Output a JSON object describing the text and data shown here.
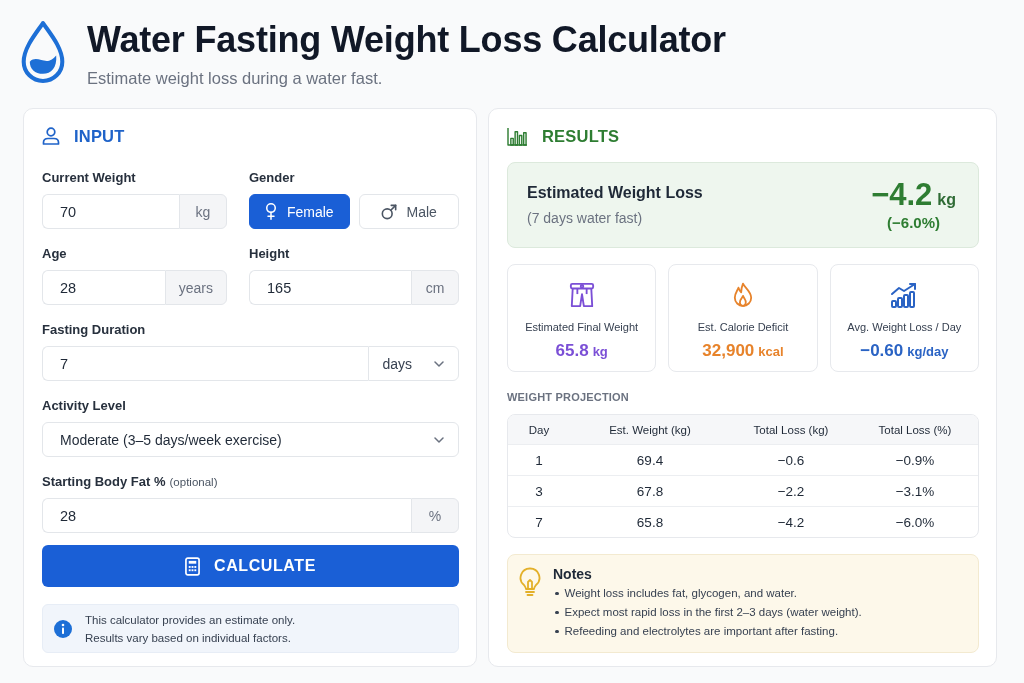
{
  "header": {
    "title": "Water Fasting Weight Loss Calculator",
    "subtitle": "Estimate weight loss during a water fast."
  },
  "input_panel": {
    "title": "INPUT",
    "rows": [
      {
        "fields": [
          {
            "kind": "unit_input",
            "label": "Current Weight",
            "value": "70",
            "unit": "kg"
          },
          {
            "kind": "toggle",
            "label": "Gender",
            "options": [
              {
                "label": "Female",
                "selected": true
              },
              {
                "label": "Male",
                "selected": false
              }
            ]
          }
        ]
      },
      {
        "fields": [
          {
            "kind": "unit_input",
            "label": "Age",
            "value": "28",
            "unit": "years"
          },
          {
            "kind": "unit_input",
            "label": "Height",
            "value": "165",
            "unit": "cm"
          }
        ]
      },
      {
        "fields": [
          {
            "kind": "unit_select",
            "label": "Fasting Duration",
            "value": "7",
            "unit": "days"
          }
        ]
      },
      {
        "fields": [
          {
            "kind": "select",
            "label": "Activity Level",
            "value": "Moderate (3–5 days/week exercise)"
          }
        ]
      },
      {
        "fields": [
          {
            "kind": "unit_input",
            "label": "Starting Body Fat %",
            "hint": "(optional)",
            "value": "28",
            "unit": "%"
          }
        ]
      }
    ],
    "button": {
      "label": "CALCULATE"
    },
    "info": {
      "lines": [
        "This calculator provides an estimate only.",
        "Results vary based on individual factors."
      ]
    }
  },
  "results_panel": {
    "title": "RESULTS",
    "summary": {
      "label": "Estimated Weight Loss",
      "sublabel": "(7 days water fast)",
      "value": "−4.2",
      "unit": "kg",
      "percent": "(−6.0%)"
    },
    "stats": [
      {
        "label": "Estimated Final Weight",
        "value": "65.8",
        "unit": "kg",
        "color": "#7b4fd6"
      },
      {
        "label": "Est. Calorie Deficit",
        "value": "32,900",
        "unit": "kcal",
        "color": "#e7832b"
      },
      {
        "label": "Avg. Weight Loss / Day",
        "value": "−0.60",
        "unit": "kg/day",
        "color": "#2a63c4"
      }
    ],
    "projection": {
      "title": "WEIGHT PROJECTION",
      "columns": [
        "Day",
        "Est. Weight (kg)",
        "Total Loss (kg)",
        "Total Loss (%)"
      ],
      "rows": [
        [
          "1",
          "69.4",
          "−0.6",
          "−0.9%"
        ],
        [
          "3",
          "67.8",
          "−2.2",
          "−3.1%"
        ],
        [
          "7",
          "65.8",
          "−4.2",
          "−6.0%"
        ]
      ]
    },
    "notes": {
      "title": "Notes",
      "items": [
        "Weight loss includes fat, glycogen, and water.",
        "Expect most rapid loss in the first 2–3 days (water weight).",
        "Refeeding and electrolytes are important after fasting."
      ]
    }
  }
}
